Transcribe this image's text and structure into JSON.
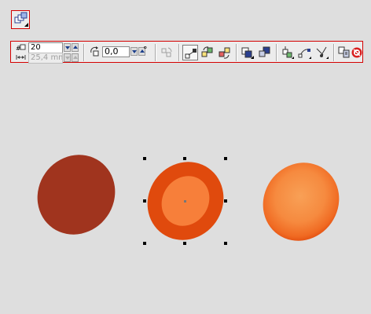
{
  "toolbar": {
    "steps": {
      "value": "20",
      "label_icon": "steps-icon"
    },
    "spacing": {
      "value": "25,4 mm",
      "label_icon": "spacing-icon",
      "disabled": true
    },
    "rotation": {
      "value": "0,0",
      "unit": "°"
    },
    "buttons": [
      "blend-tool-icon",
      "rotate-icon",
      "path-icon",
      "direct-blend-icon",
      "clockwise-blend-icon",
      "counterclockwise-blend-icon",
      "object-color-acceleration-icon",
      "acceleration-icon",
      "start-end-properties-icon",
      "path-properties-icon",
      "more-blend-options-icon",
      "copy-blend-properties-icon",
      "clear-blend-icon"
    ]
  },
  "colors": {
    "dark_ellipse": "#a0341e",
    "outer_ring": "#e04a0d",
    "inner_fill": "#f77f3a",
    "blend_light": "#f8a056",
    "toolbar_frame": "#d40000"
  }
}
